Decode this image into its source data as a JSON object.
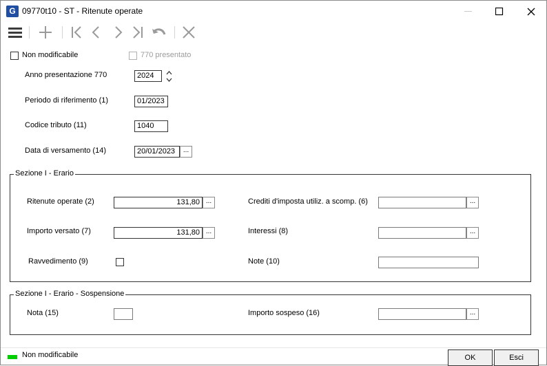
{
  "window": {
    "app_icon_letter": "G",
    "title": "09770t10 - ST - Ritenute operate"
  },
  "toolbar": {
    "items": [
      "menu-icon",
      "add-icon",
      "first-icon",
      "prev-icon",
      "next-icon",
      "last-icon",
      "undo-icon",
      "delete-icon"
    ]
  },
  "header": {
    "non_modificabile_label": "Non modificabile",
    "presentato_770_label": "770 presentato",
    "anno_label": "Anno presentazione 770",
    "anno_value": "2024",
    "periodo_label": "Periodo di riferimento (1)",
    "periodo_value": "01/2023",
    "codice_label": "Codice tributo (11)",
    "codice_value": "1040",
    "data_label": "Data di versamento (14)",
    "data_value": "20/01/2023"
  },
  "sezione_erario": {
    "title": "Sezione I - Erario",
    "ritenute_label": "Ritenute operate (2)",
    "ritenute_value": "131,80",
    "importo_label": "Importo versato (7)",
    "importo_value": "131,80",
    "ravvedimento_label": "Ravvedimento (9)",
    "crediti_label": "Crediti d'imposta utiliz. a scomp. (6)",
    "crediti_value": "",
    "interessi_label": "Interessi (8)",
    "interessi_value": "",
    "note_label": "Note (10)",
    "note_value": ""
  },
  "sezione_sospensione": {
    "title": "Sezione I - Erario  - Sospensione",
    "nota_label": "Nota (15)",
    "nota_value": "",
    "importo_sospeso_label": "Importo sospeso (16)",
    "importo_sospeso_value": ""
  },
  "ellipsis": "...",
  "statusbar": {
    "status_text": "Non modificabile",
    "status_color": "#00d000",
    "ok_label": "OK",
    "esci_label": "Esci"
  }
}
